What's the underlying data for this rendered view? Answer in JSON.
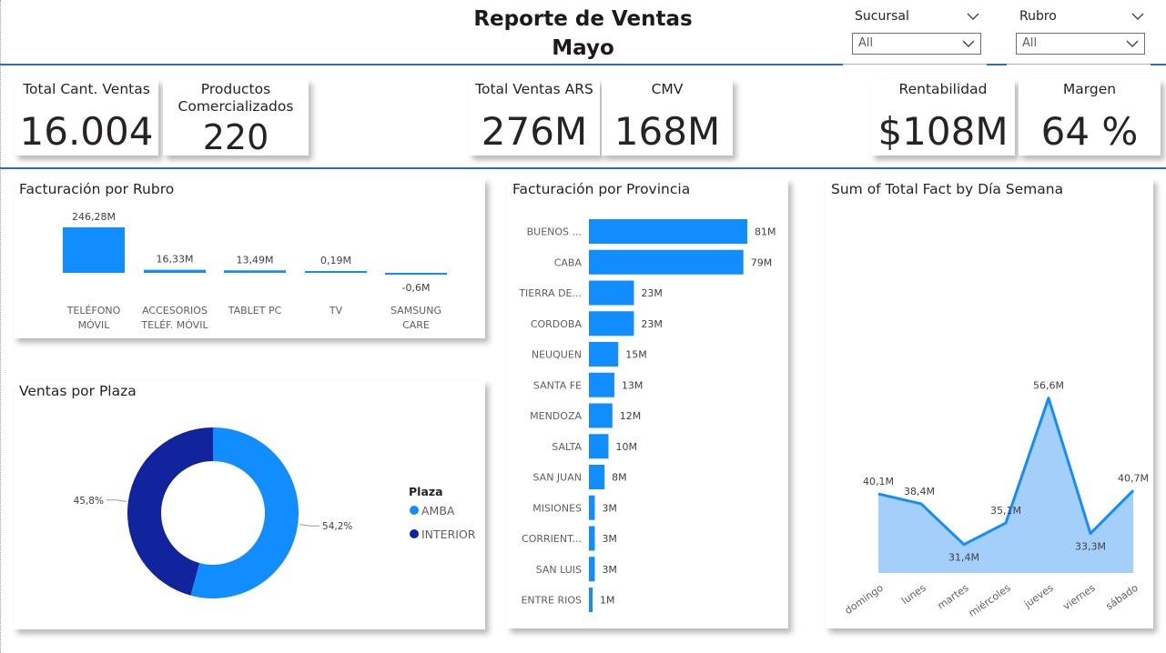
{
  "report": {
    "title_line1": "Reporte de Ventas",
    "title_line2": "Mayo"
  },
  "slicers": [
    {
      "label": "Sucursal",
      "value": "All"
    },
    {
      "label": "Rubro",
      "value": "All"
    }
  ],
  "kpis": {
    "total_cant_ventas": {
      "label": "Total Cant. Ventas",
      "value": "16.004"
    },
    "productos": {
      "label_line1": "Productos",
      "label_line2": "Comercializados",
      "value": "220"
    },
    "total_ventas_ars": {
      "label": "Total Ventas ARS",
      "value": "276M"
    },
    "cmv": {
      "label": "CMV",
      "value": "168M"
    },
    "rentabilidad": {
      "label": "Rentabilidad",
      "value": "$108M"
    },
    "margen": {
      "label": "Margen",
      "value": "64 %"
    }
  },
  "colors": {
    "accent": "#118DFF",
    "dark": "#12239E",
    "area": "#A5CFFB",
    "rule": "#2C6FB7"
  },
  "chart_data": [
    {
      "type": "bar",
      "title": "Facturación por Rubro",
      "categories": [
        [
          "TELÉFONO",
          "MÓVIL"
        ],
        [
          "ACCESORIOS",
          "TELÉF. MÓVIL"
        ],
        [
          "TABLET PC"
        ],
        [
          "TV"
        ],
        [
          "SAMSUNG",
          "CARE"
        ]
      ],
      "values": [
        246.28,
        16.33,
        13.49,
        0.19,
        -0.6
      ],
      "labels": [
        "246,28M",
        "16,33M",
        "13,49M",
        "0,19M",
        "-0,6M"
      ]
    },
    {
      "type": "bar",
      "orientation": "horizontal",
      "title": "Facturación por Provincia",
      "categories": [
        "BUENOS ...",
        "CABA",
        "TIERRA DE...",
        "CORDOBA",
        "NEUQUEN",
        "SANTA FE",
        "MENDOZA",
        "SALTA",
        "SAN JUAN",
        "MISIONES",
        "CORRIENT...",
        "SAN LUIS",
        "ENTRE RIOS"
      ],
      "values": [
        81,
        79,
        23,
        23,
        15,
        13,
        12,
        10,
        8,
        3,
        3,
        3,
        1
      ],
      "labels": [
        "81M",
        "79M",
        "23M",
        "23M",
        "15M",
        "13M",
        "12M",
        "10M",
        "8M",
        "3M",
        "3M",
        "3M",
        "1M"
      ]
    },
    {
      "type": "pie",
      "title": "Ventas por Plaza",
      "legend_title": "Plaza",
      "categories": [
        "AMBA",
        "INTERIOR"
      ],
      "values": [
        54.2,
        45.8
      ],
      "labels": [
        "54,2%",
        "45,8%"
      ]
    },
    {
      "type": "area",
      "title": "Sum of Total Fact by Día Semana",
      "categories": [
        "domingo",
        "lunes",
        "martes",
        "miércoles",
        "jueves",
        "viernes",
        "sábado"
      ],
      "values": [
        40.1,
        38.4,
        31.4,
        35.1,
        56.6,
        33.3,
        40.7
      ],
      "labels": [
        "40,1M",
        "38,4M",
        "31,4M",
        "35,1M",
        "56,6M",
        "33,3M",
        "40,7M"
      ]
    }
  ]
}
